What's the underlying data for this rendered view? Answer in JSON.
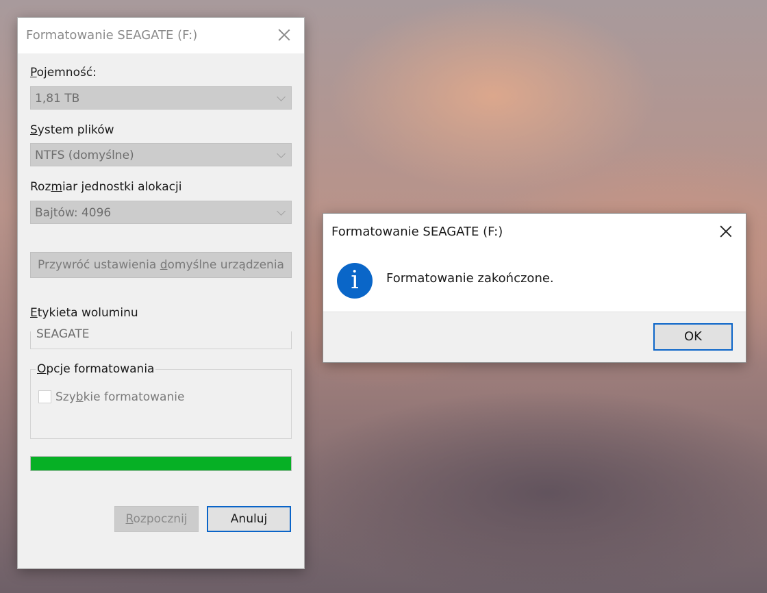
{
  "format_dialog": {
    "title": "Formatowanie SEAGATE (F:)",
    "capacity": {
      "label_pre": "",
      "label_key": "P",
      "label_post": "ojemność:",
      "value": "1,81 TB"
    },
    "file_system": {
      "label_pre": "",
      "label_key": "S",
      "label_post": "ystem plików",
      "value": "NTFS (domyślne)"
    },
    "allocation_unit": {
      "label_pre": "Roz",
      "label_key": "m",
      "label_post": "iar jednostki alokacji",
      "value": "Bajtów: 4096"
    },
    "restore_defaults": {
      "label_pre": "Przywróć ustawienia ",
      "label_key": "d",
      "label_post": "omyślne urządzenia"
    },
    "volume_label": {
      "label_pre": "",
      "label_key": "E",
      "label_post": "tykieta woluminu",
      "value": "SEAGATE"
    },
    "format_options": {
      "legend_pre": "",
      "legend_key": "O",
      "legend_post": "pcje formatowania",
      "quick_format": {
        "label_pre": "Szy",
        "label_key": "b",
        "label_post": "kie formatowanie",
        "checked": false
      }
    },
    "progress_percent": 100,
    "progress_color": "#06b025",
    "buttons": {
      "start_pre": "",
      "start_key": "R",
      "start_post": "ozpocznij",
      "cancel": "Anuluj"
    }
  },
  "message_box": {
    "title": "Formatowanie SEAGATE (F:)",
    "icon": "info-icon",
    "icon_glyph": "i",
    "message": "Formatowanie zakończone.",
    "ok": "OK",
    "accent": "#0a66c8"
  }
}
